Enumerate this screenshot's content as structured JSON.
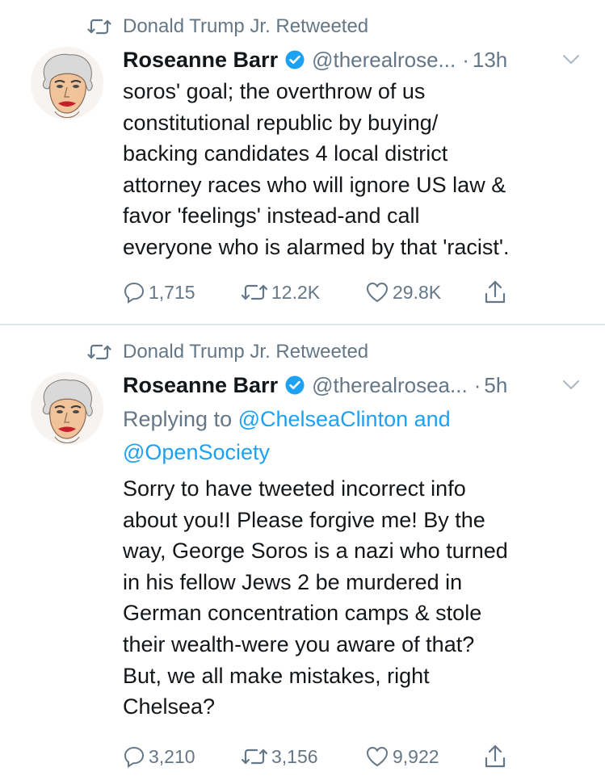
{
  "tweets": [
    {
      "retweeted_by": "Donald Trump Jr. Retweeted",
      "author": {
        "name": "Roseanne Barr",
        "handle": "@therealrose...",
        "time": "13h"
      },
      "body": "soros' goal; the overthrow of us\nconstitutional republic by buying/\nbacking candidates 4 local district\nattorney races who will ignore US law &\nfavor 'feelings' instead-and call\neveryone who is alarmed by that 'racist'.",
      "stats": {
        "replies": "1,715",
        "retweets": "12.2K",
        "likes": "29.8K"
      }
    },
    {
      "retweeted_by": "Donald Trump Jr. Retweeted",
      "author": {
        "name": "Roseanne Barr",
        "handle": "@therealrosea...",
        "time": "5h"
      },
      "replying_prefix": "Replying to ",
      "replying_mentions": "@ChelseaClinton and\n@OpenSociety",
      "body": "Sorry to have tweeted incorrect info\nabout you!I Please forgive me! By the\nway, George Soros is a nazi who turned\nin his fellow Jews 2 be murdered in\nGerman concentration camps & stole\ntheir wealth-were you aware of that?\nBut, we all make mistakes, right\nChelsea?",
      "stats": {
        "replies": "3,210",
        "retweets": "3,156",
        "likes": "9,922"
      }
    }
  ],
  "icons": {
    "retweet": "retweet-icon",
    "verified": "verified-badge-icon",
    "more": "chevron-down-icon",
    "reply": "reply-icon",
    "like": "heart-icon",
    "share": "share-icon"
  },
  "colors": {
    "text": "#14171a",
    "secondary": "#657786",
    "accent": "#1da1f2",
    "divider": "#e1e8ed"
  }
}
